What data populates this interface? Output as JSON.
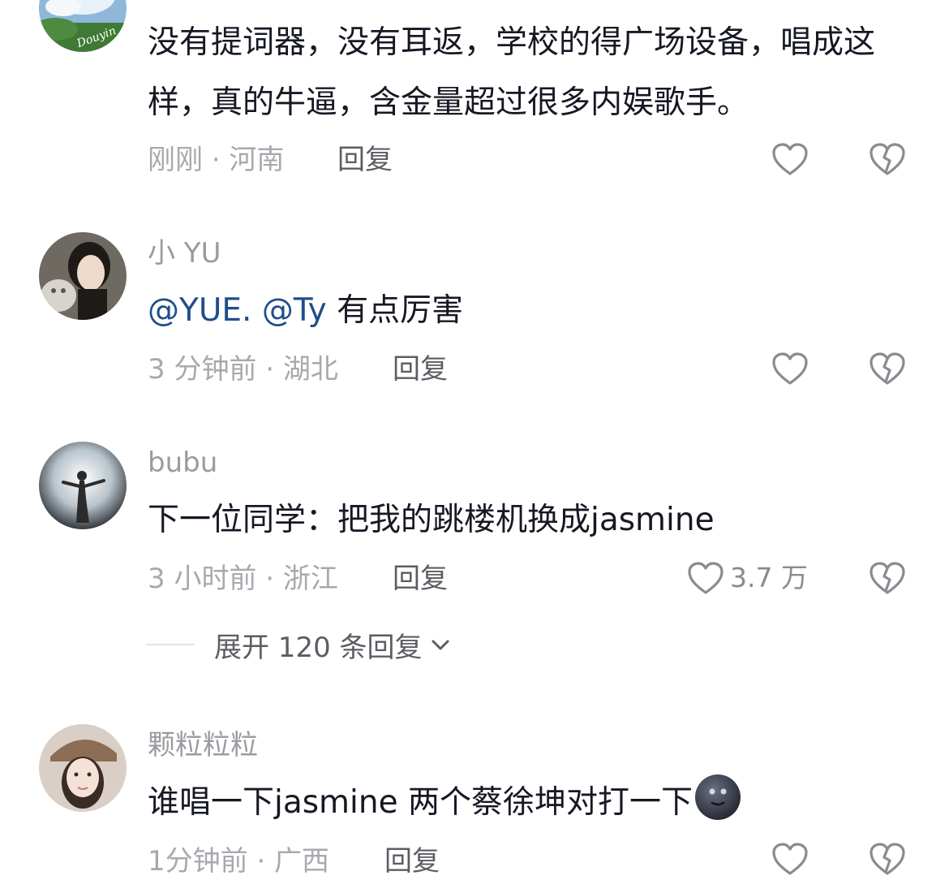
{
  "comments": [
    {
      "username": "",
      "text": "没有提词器，没有耳返，学校的得广场设备，唱成这样，真的牛逼，含金量超过很多内娱歌手。",
      "time_location": "刚刚 · 河南",
      "reply_label": "回复",
      "like_count": ""
    },
    {
      "username": "小 YU",
      "mentions": [
        "@YUE.",
        "@Ty"
      ],
      "text": "有点厉害",
      "time_location": "3 分钟前 · 湖北",
      "reply_label": "回复",
      "like_count": ""
    },
    {
      "username": "bubu",
      "text": "下一位同学：把我的跳楼机换成jasmine",
      "time_location": "3 小时前 · 浙江",
      "reply_label": "回复",
      "like_count": "3.7 万",
      "expand_replies": "展开 120 条回复"
    },
    {
      "username": "颗粒粒粒",
      "text": "谁唱一下jasmine 两个蔡徐坤对打一下",
      "emoji": "moon-face-emoji",
      "time_location": "1分钟前 · 广西",
      "reply_label": "回复",
      "like_count": ""
    }
  ],
  "avatar_1_watermark": "Douyin",
  "colors": {
    "text": "#161823",
    "mention": "#1e4e8c",
    "meta": "#a8a9ae",
    "reply": "#5c5d63",
    "icon": "#8a8b90"
  },
  "icons": [
    "heart-outline-icon",
    "broken-heart-icon",
    "chevron-down-icon"
  ]
}
